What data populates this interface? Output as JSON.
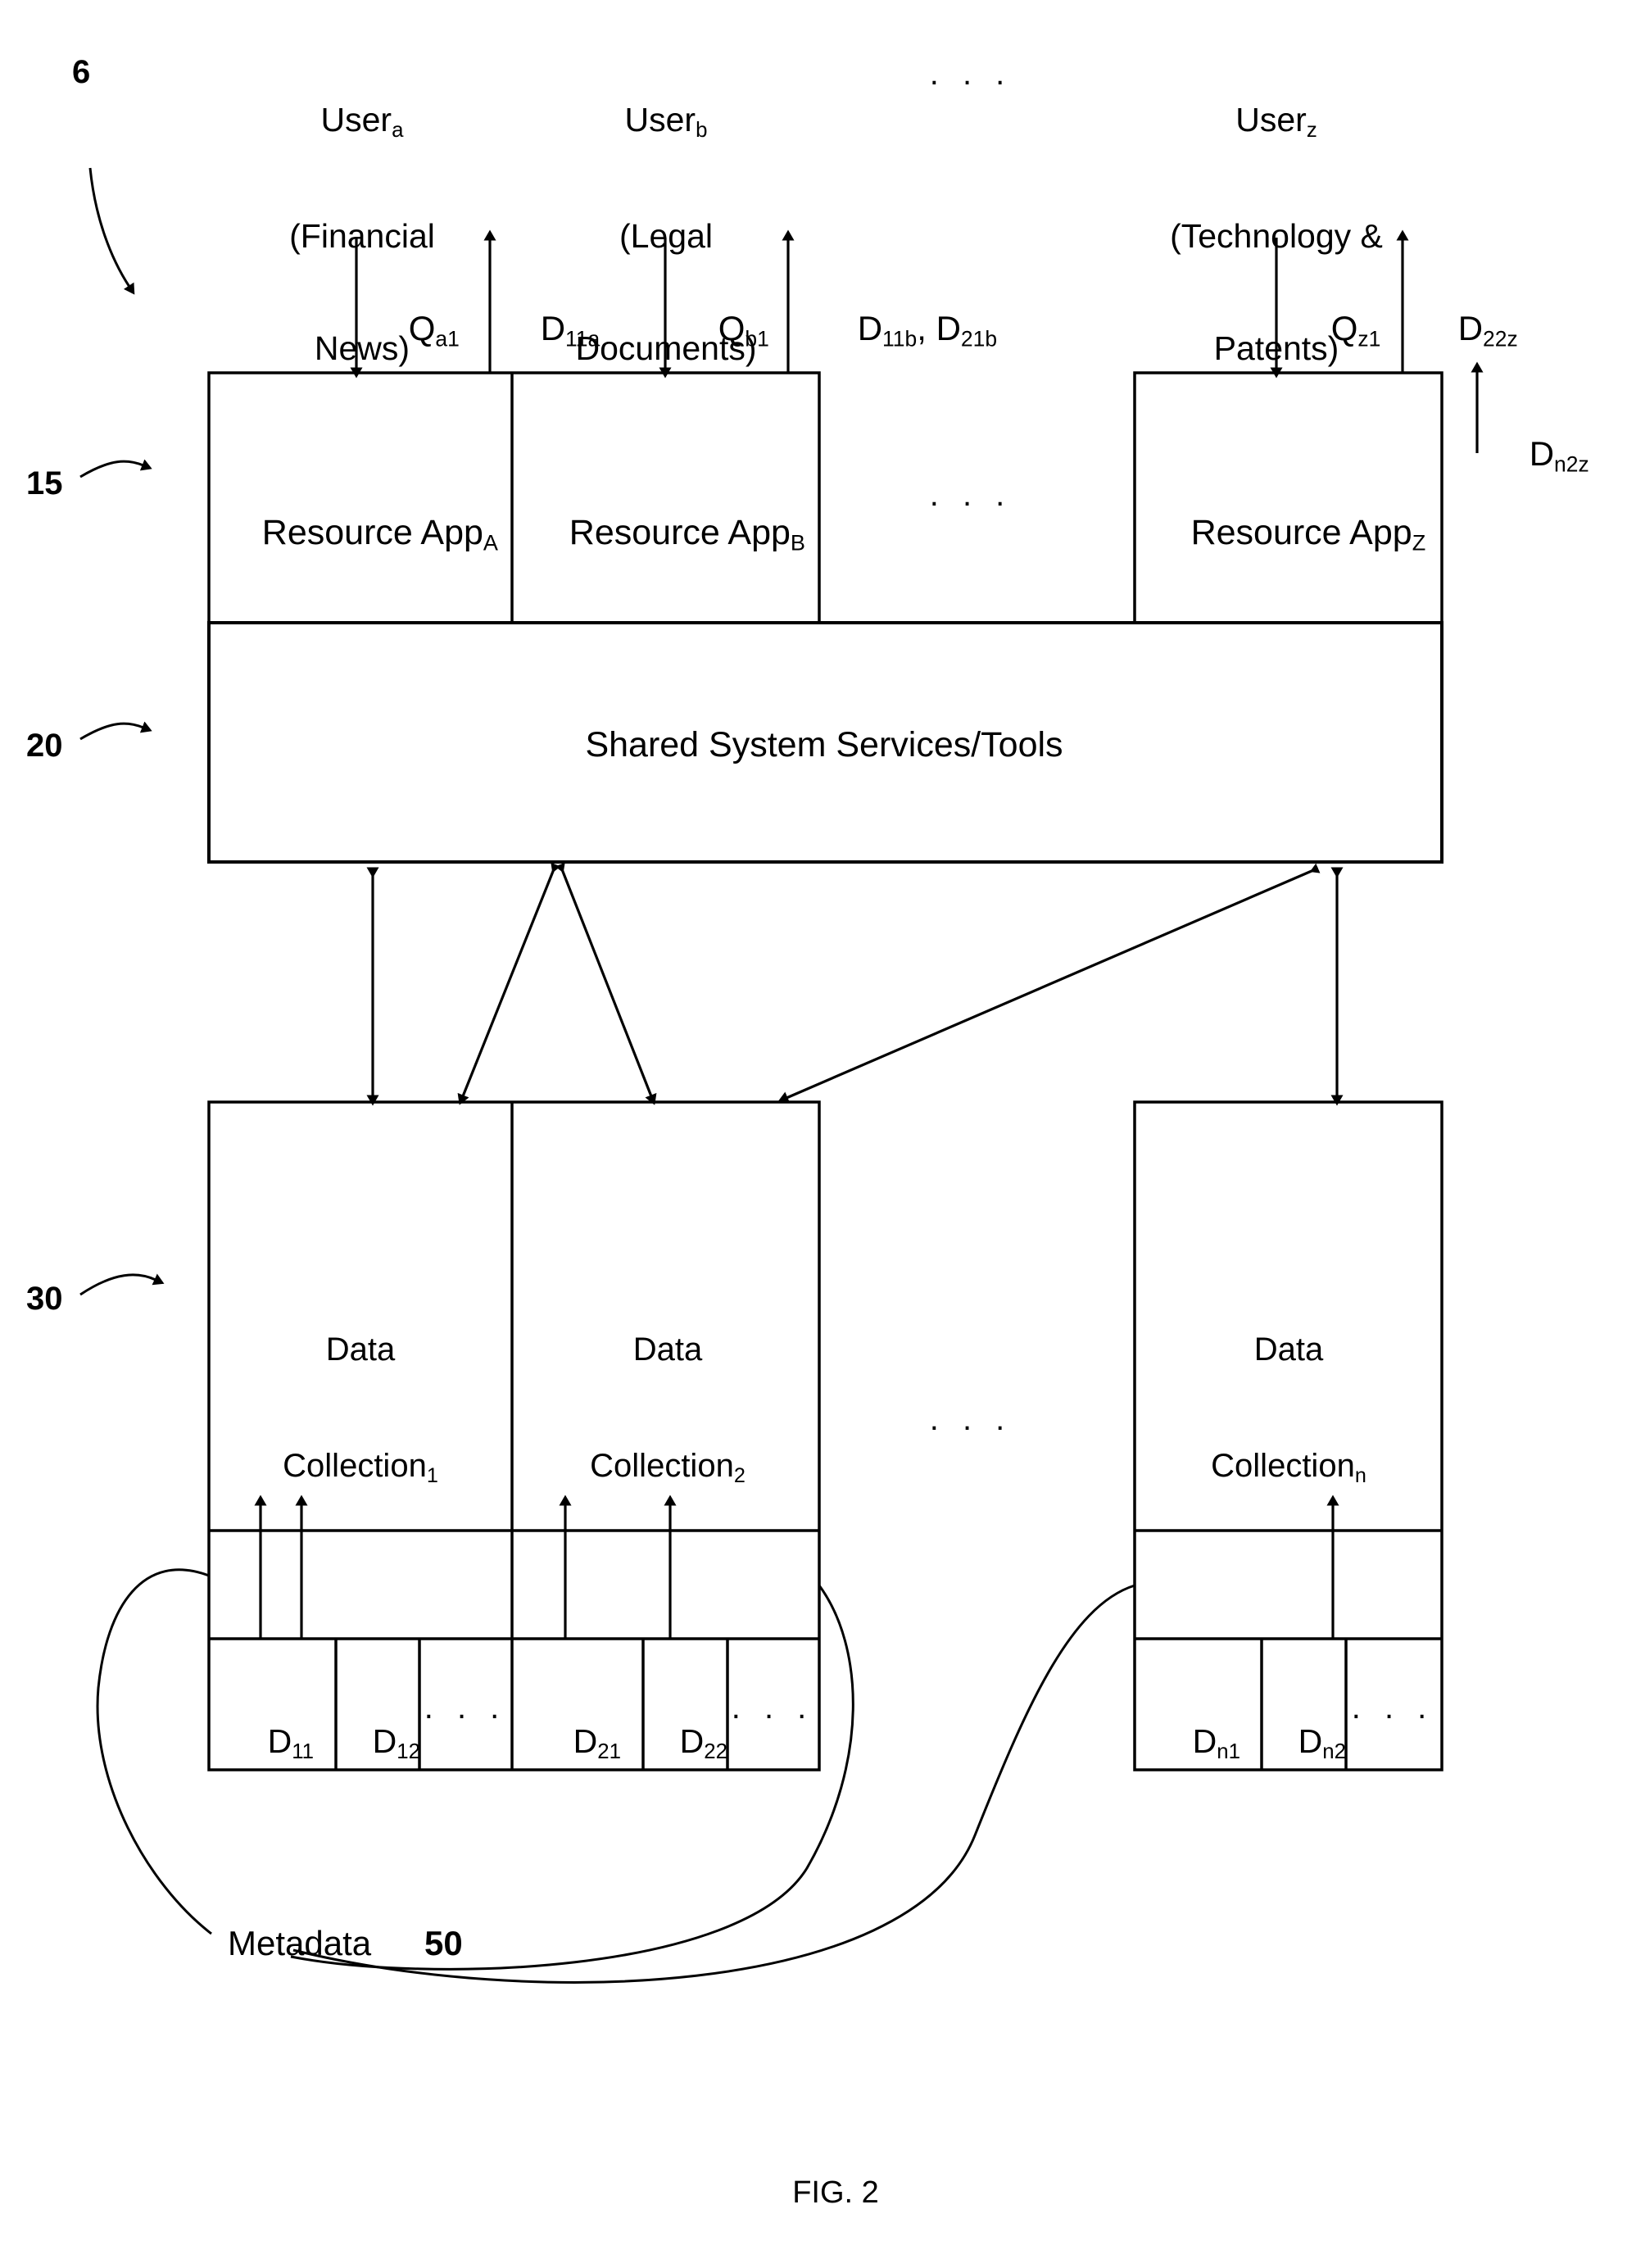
{
  "figure": {
    "caption": "FIG. 2",
    "system_ref": "6"
  },
  "users": [
    {
      "name": "User",
      "sub": "a",
      "descriptor": "(Financial News)",
      "line1": "(Financial",
      "line2": "News)"
    },
    {
      "name": "User",
      "sub": "b",
      "descriptor": "(Legal Documents)",
      "line1": "(Legal",
      "line2": "Documents)"
    },
    {
      "ellipsis": ". . ."
    },
    {
      "name": "User",
      "sub": "z",
      "descriptor": "(Technology & Patents)",
      "line1": "(Technology &",
      "line2": "Patents)"
    }
  ],
  "flow_labels": {
    "query_a": {
      "base": "Q",
      "sub": "a1"
    },
    "doc_a": {
      "base": "D",
      "sub": "11a"
    },
    "query_b": {
      "base": "Q",
      "sub": "b1"
    },
    "doc_b1": {
      "base": "D",
      "sub": "11b"
    },
    "doc_b2": {
      "base": "D",
      "sub": "21b"
    },
    "doc_b_separator": ", ",
    "query_z": {
      "base": "Q",
      "sub": "z1"
    },
    "doc_z": {
      "base": "D",
      "sub": "22z"
    },
    "doc_nz": {
      "base": "D",
      "sub": "n2z"
    }
  },
  "resource_layer": {
    "ref": "15",
    "apps": [
      {
        "base": "Resource App",
        "sub": "A"
      },
      {
        "base": "Resource App",
        "sub": "B"
      },
      {
        "base": "Resource App",
        "sub": "Z"
      }
    ],
    "ellipsis": ". . ."
  },
  "services_layer": {
    "ref": "20",
    "label": "Shared System Services/Tools"
  },
  "data_layer": {
    "ref": "30",
    "ellipsis": ". . .",
    "collections": [
      {
        "title_line1": "Data",
        "title_line2": "Collection",
        "sub": "1",
        "documents": [
          {
            "base": "D",
            "sub": "11"
          },
          {
            "base": "D",
            "sub": "12"
          },
          {
            "ellipsis": ". . ."
          }
        ]
      },
      {
        "title_line1": "Data",
        "title_line2": "Collection",
        "sub": "2",
        "documents": [
          {
            "base": "D",
            "sub": "21"
          },
          {
            "base": "D",
            "sub": "22"
          },
          {
            "ellipsis": ". . ."
          }
        ]
      },
      {
        "title_line1": "Data",
        "title_line2": "Collection",
        "sub": "n",
        "documents": [
          {
            "base": "D",
            "sub": "n1"
          },
          {
            "base": "D",
            "sub": "n2"
          },
          {
            "ellipsis": ". . ."
          }
        ]
      }
    ]
  },
  "metadata": {
    "label": "Metadata",
    "ref": "50"
  },
  "colors": {
    "stroke": "#000000",
    "background": "#ffffff"
  }
}
